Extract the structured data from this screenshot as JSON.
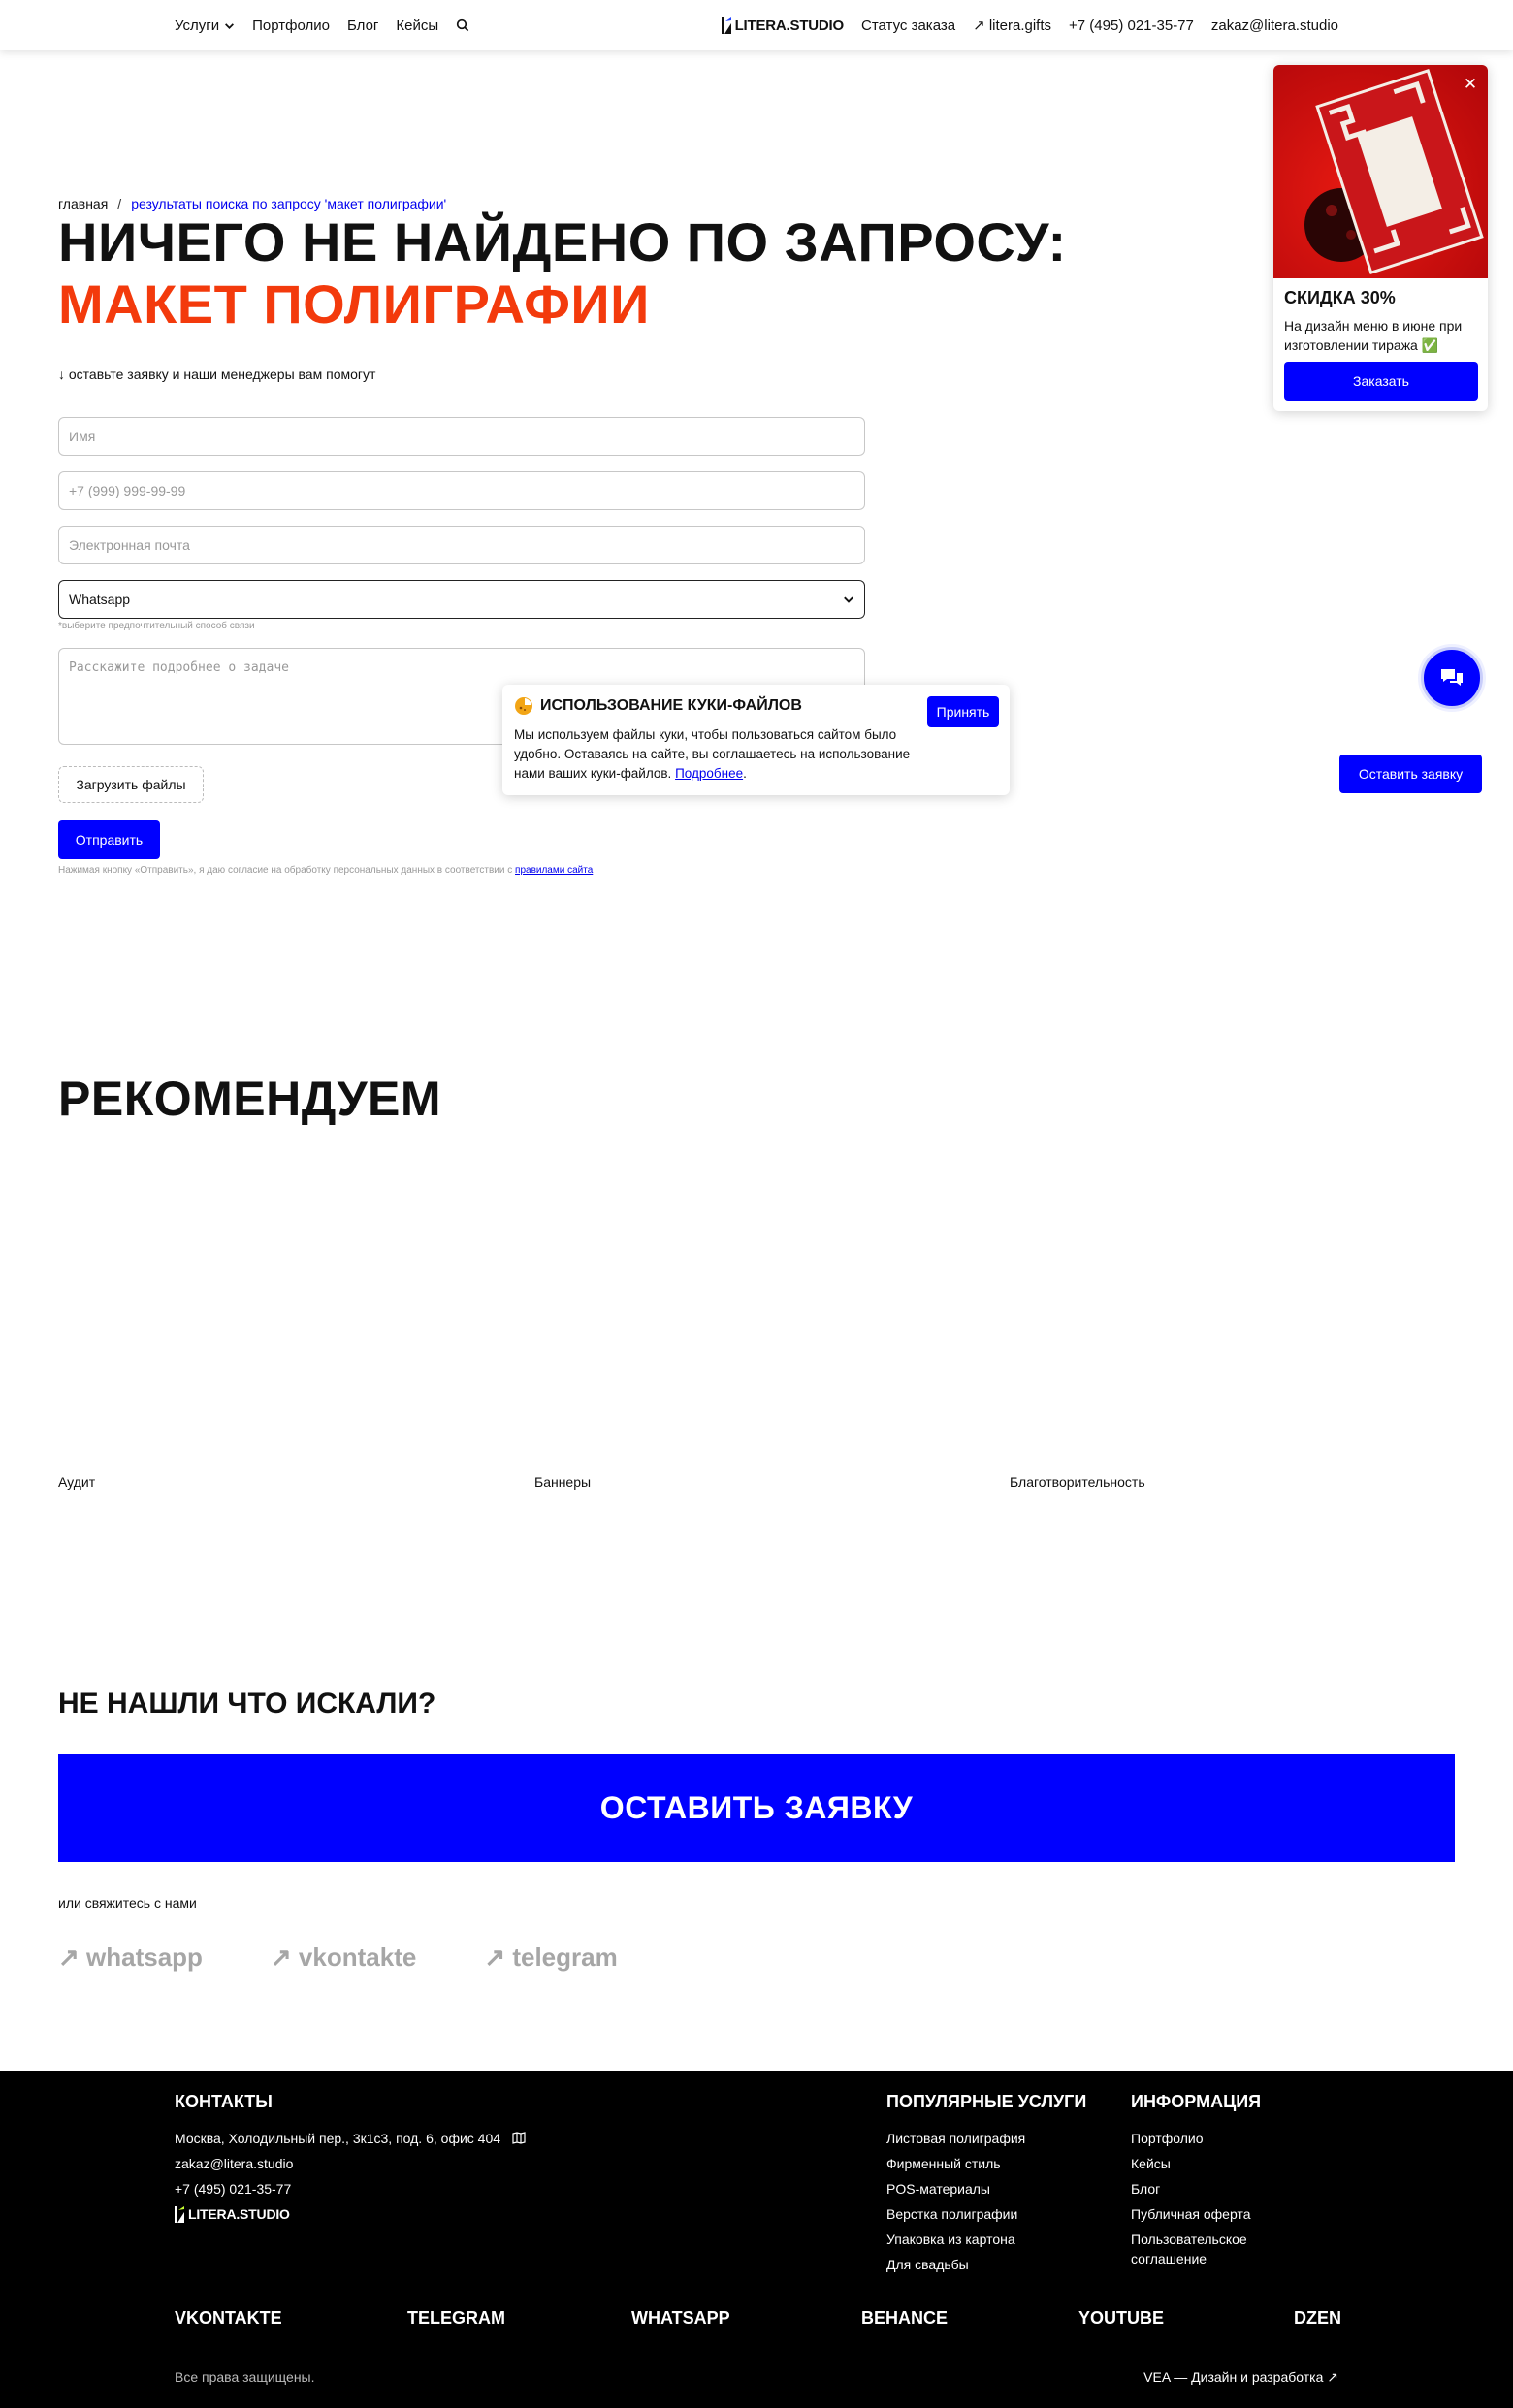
{
  "header": {
    "services": "Услуги",
    "portfolio": "Портфолио",
    "blog": "Блог",
    "cases": "Кейсы",
    "logo": "LITERA.STUDIO",
    "order_status": "Статус заказа",
    "gifts": "↗ litera.gifts",
    "phone": "+7 (495) 021-35-77",
    "email": "zakaz@litera.studio"
  },
  "breadcrumb": {
    "home": "главная",
    "sep": "/",
    "current": "результаты поиска по запросу 'макет полиграфии'"
  },
  "page": {
    "title_prefix": "Ничего не найдено по запросу: ",
    "query": "макет полиграфии",
    "hint": "↓ оставьте заявку и наши менеджеры вам помогут"
  },
  "form": {
    "name_placeholder": "Имя",
    "phone_placeholder": "+7 (999) 999-99-99",
    "email_placeholder": "Электронная почта",
    "contact_value": "Whatsapp",
    "contact_hint": "*выберите предпочтительный способ связи",
    "task_placeholder": "Расскажите подробнее о задаче",
    "upload": "Загрузить файлы",
    "submit": "Отправить",
    "consent": "Нажимая кнопку «Отправить», я даю согласие на обработку персональных данных в соответствии с",
    "consent_link": "правилами сайта"
  },
  "cookie": {
    "title": "Использование куки-файлов",
    "text": "Мы используем файлы куки, чтобы пользоваться сайтом было удобно. Оставаясь на сайте, вы соглашаетесь на использование нами ваших куки-файлов.",
    "link": "Подробнее",
    "accept": "Принять"
  },
  "promo": {
    "title": "СКИДКА 30%",
    "text": "На дизайн меню в июне при изготовлении тиража ✅",
    "order": "Заказать"
  },
  "leave_request": "Оставить заявку",
  "recommend": {
    "title": "Рекомендуем",
    "items": [
      "Аудит",
      "Баннеры",
      "Благотворительность"
    ]
  },
  "not_found": {
    "title": "Не нашли что искали?",
    "button": "Оставить заявку",
    "contact_hint": "или свяжитесь с нами",
    "socials": [
      "↗ whatsapp",
      "↗ vkontakte",
      "↗ telegram"
    ]
  },
  "footer": {
    "contacts_title": "Контакты",
    "address": "Москва, Холодильный пер., 3к1с3, под. 6, офис 404",
    "email": "zakaz@litera.studio",
    "phone": "+7 (495) 021-35-77",
    "logo": "LITERA.STUDIO",
    "services_title": "Популярные услуги",
    "services": [
      "Листовая полиграфия",
      "Фирменный стиль",
      "POS-материалы",
      "Верстка полиграфии",
      "Упаковка из картона",
      "Для свадьбы"
    ],
    "info_title": "Информация",
    "info": [
      "Портфолио",
      "Кейсы",
      "Блог",
      "Публичная оферта",
      "Пользовательское соглашение"
    ],
    "socials": [
      "VKONTAKTE",
      "TELEGRAM",
      "WHATSAPP",
      "BEHANCE",
      "YOUTUBE",
      "DZEN"
    ],
    "rights": "Все права защищены.",
    "dev": "VEA — Дизайн и разработка ↗"
  },
  "colors": {
    "accent": "#0000ff",
    "query": "#f33a0c",
    "footer_bg": "#000000"
  }
}
